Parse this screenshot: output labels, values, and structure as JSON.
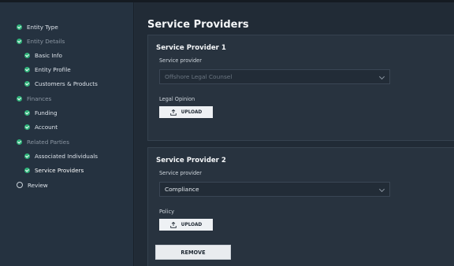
{
  "sidebar": {
    "items": [
      {
        "label": "Entity Type",
        "status": "complete",
        "level": "top"
      },
      {
        "label": "Entity Details",
        "status": "complete",
        "level": "parent"
      },
      {
        "label": "Basic Info",
        "status": "complete",
        "level": "child"
      },
      {
        "label": "Entity Profile",
        "status": "complete",
        "level": "child"
      },
      {
        "label": "Customers & Products",
        "status": "complete",
        "level": "child"
      },
      {
        "label": "Finances",
        "status": "complete",
        "level": "parent"
      },
      {
        "label": "Funding",
        "status": "complete",
        "level": "child"
      },
      {
        "label": "Account",
        "status": "complete",
        "level": "child"
      },
      {
        "label": "Related Parties",
        "status": "complete",
        "level": "parent"
      },
      {
        "label": "Associated Individuals",
        "status": "complete",
        "level": "child"
      },
      {
        "label": "Service Providers",
        "status": "complete",
        "level": "child",
        "active": true
      },
      {
        "label": "Review",
        "status": "incomplete",
        "level": "top"
      }
    ]
  },
  "main": {
    "title": "Service Providers",
    "provider1": {
      "title": "Service Provider 1",
      "provider_label": "Service provider",
      "provider_value": "Offshore Legal Counsel",
      "doc_label": "Legal Opinion",
      "upload_label": "UPLOAD"
    },
    "provider2": {
      "title": "Service Provider 2",
      "provider_label": "Service provider",
      "provider_value": "Compliance",
      "doc_label": "Policy",
      "upload_label": "UPLOAD"
    },
    "remove_label": "REMOVE"
  },
  "colors": {
    "complete": "#2fb37a",
    "background": "#212b36",
    "sidebar": "#253240"
  },
  "icons": {
    "complete": "check-circle-icon",
    "incomplete": "empty-circle-icon",
    "upload": "upload-icon",
    "dropdown": "chevron-down-icon"
  }
}
